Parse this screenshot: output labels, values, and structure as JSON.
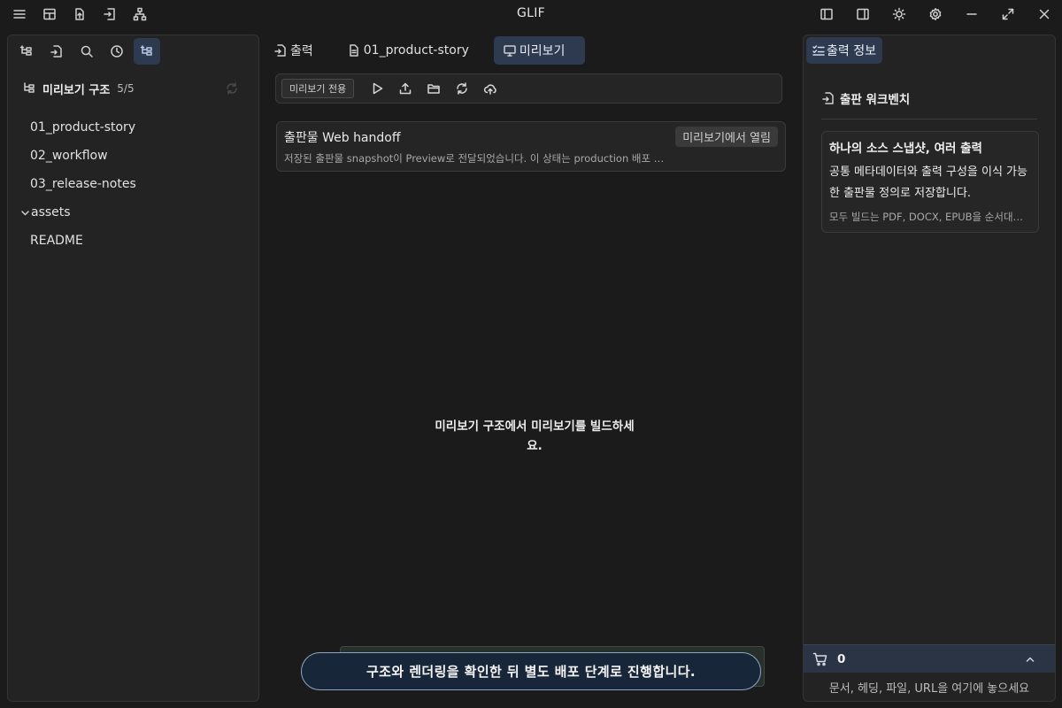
{
  "app": {
    "title": "GLIF"
  },
  "titlebar": {
    "left_icons": [
      "menu-icon",
      "layout-icon",
      "file-export-icon",
      "sign-in-icon",
      "sitemap-icon"
    ],
    "right_icons": [
      "sidebar-left-icon",
      "sidebar-right-icon",
      "theme-sun-icon",
      "gear-icon",
      "minimize-icon",
      "maximize-icon",
      "close-icon"
    ]
  },
  "left_panel": {
    "toolbar_icons": [
      "tree-structure-icon",
      "export-icon",
      "search-icon",
      "history-clock-icon",
      "tree-structure-active-icon"
    ],
    "header": {
      "title": "미리보기 구조",
      "count": "5/5"
    },
    "items": [
      {
        "label": "01_product-story",
        "type": "file"
      },
      {
        "label": "02_workflow",
        "type": "file"
      },
      {
        "label": "03_release-notes",
        "type": "file"
      },
      {
        "label": "assets",
        "type": "folder"
      },
      {
        "label": "README",
        "type": "file"
      }
    ]
  },
  "center": {
    "tabs": [
      {
        "label": "출력",
        "icon": "export-icon"
      },
      {
        "label": "01_product-story",
        "icon": "document-icon"
      },
      {
        "label": "미리보기",
        "icon": "monitor-icon",
        "active": true
      }
    ],
    "action_bar": {
      "chip": "미리보기 전용",
      "buttons": [
        "play-icon",
        "upload-icon",
        "folder-open-icon",
        "refresh-icon",
        "cloud-upload-icon"
      ]
    },
    "card": {
      "title": "출판물 Web handoff",
      "badge": "미리보기에서 열림",
      "description": "저장된 출판물 snapshot이 Preview로 전달되었습니다. 이 상태는 production 배포 완료를 의미하지 않습니다."
    },
    "empty_message": "미리보기 구조에서 미리보기를 빌드하세요."
  },
  "right_panel": {
    "tab": {
      "label": "출력 정보",
      "icon": "checklist-icon"
    },
    "workbench": {
      "title": "출판 워크벤치"
    },
    "info_card": {
      "title": "하나의 소스 스냅샷, 여러 출력",
      "body": "공통 메타데이터와 출력 구성을 이식 가능한 출판물 정의로 저장합니다.",
      "footer": "모두 빌드는 PDF, DOCX, EPUB을 순서대로 실행합니다."
    },
    "cart": {
      "count": "0"
    },
    "drop_zone": "문서, 헤딩, 파일, URL을 여기에 놓으세요"
  },
  "toast": {
    "message": "구조와 렌더링을 확인한 뒤 별도 배포 단계로 진행합니다."
  },
  "colors": {
    "background": "#1b1b1b",
    "panel": "#232323",
    "accent": "#2e3a4f",
    "toast_border": "#8fa5c3"
  }
}
